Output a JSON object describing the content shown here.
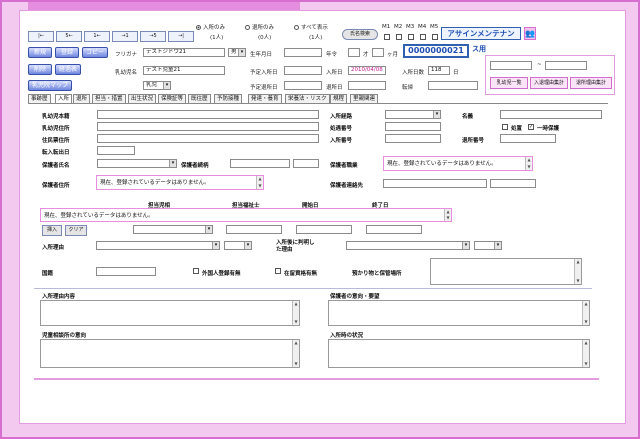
{
  "nav": {
    "first": "|←",
    "prev5": "5←",
    "prev": "1←",
    "next": "→1",
    "next5": "→5",
    "last": "→|"
  },
  "buttons": {
    "new": "新規",
    "register": "登録",
    "copy": "コピー",
    "delete": "削除",
    "history": "経過表",
    "map": "乳児院マップ",
    "insert": "挿入",
    "clear": "クリア"
  },
  "filter": {
    "options": [
      {
        "label": "入所のみ",
        "count": "(1人)",
        "selected": true
      },
      {
        "label": "退所のみ",
        "count": "(0人)",
        "selected": false
      },
      {
        "label": "すべて表示",
        "count": "(1人)",
        "selected": false
      }
    ],
    "search_button": "氏名検索",
    "m_labels": [
      "M1",
      "M2",
      "M3",
      "M4",
      "M5"
    ]
  },
  "header": {
    "assign_label": "アサインメンテナン",
    "id_value": "0000000021",
    "use_label": "ス用",
    "person_icon": "people-icon"
  },
  "top": {
    "kana_label": "フリガナ",
    "kana_value": "テストジドウ21",
    "gender_value": "男",
    "birth_label": "生年月日",
    "age_label": "年令",
    "age_unit": "才",
    "month_unit": "ヶ月",
    "child_name_label": "乳幼児名",
    "child_name_value": "テスト児童21",
    "planned_in_label": "予定入所日",
    "in_label": "入所日",
    "in_value": "2010/04/08",
    "days_label": "入所日数",
    "days_value": "118",
    "days_unit": "日",
    "category_value": "乳児",
    "planned_out_label": "予定退所日",
    "out_label": "退所日",
    "transfer_label": "転帰",
    "date_sep": "~",
    "pink_buttons": [
      "乳幼児一覧",
      "入退理由集計",
      "退所理由集計"
    ]
  },
  "tabs": [
    "事跡歴",
    "入所",
    "退所",
    "担当・措置",
    "出生状況",
    "保険証等",
    "既往歴",
    "予防接種",
    "発達・養育",
    "栄養法・リスク",
    "規程",
    "里親関連"
  ],
  "form": {
    "address_label": "乳幼児本籍",
    "current_address_label": "乳幼児住所",
    "resident_label": "住民票住所",
    "transfer_date_label": "転入転出日",
    "route_label": "入所経路",
    "office_label": "処遇番号",
    "entry_no_label": "入所番号",
    "name_label": "名義",
    "disposal_label": "処置",
    "temp_guard_label": "一時保護",
    "return_no_label": "退所番号",
    "guardian_name_label": "保護者氏名",
    "guardian_relation_label": "保護者続柄",
    "guardian_job_label": "保護者職業",
    "guardian_address_label": "保護者住所",
    "guardian_contact_label": "保護者連絡先",
    "no_data": "現在、登録されているデータはありません。",
    "history_headers": [
      "担当児相",
      "担当福祉士",
      "開始日",
      "終了日"
    ],
    "reason_label": "入所理由",
    "after_reason_label": "入所後に判明した理由",
    "nationality_label": "国籍",
    "foreign_label": "外国人登録有無",
    "status_label": "在留資格有無",
    "belongings_label": "預かり物と保管場所",
    "reason_detail_label": "入所理由内容",
    "guardian_wish_label": "保護者の意向・要望",
    "consult_label": "児童相談所の意向",
    "condition_label": "入所時の状況"
  },
  "colors": {
    "frame": "#f4c9ef",
    "accent": "#e58ddf",
    "button": "#6f86df",
    "id_text": "#1f4fb3"
  }
}
